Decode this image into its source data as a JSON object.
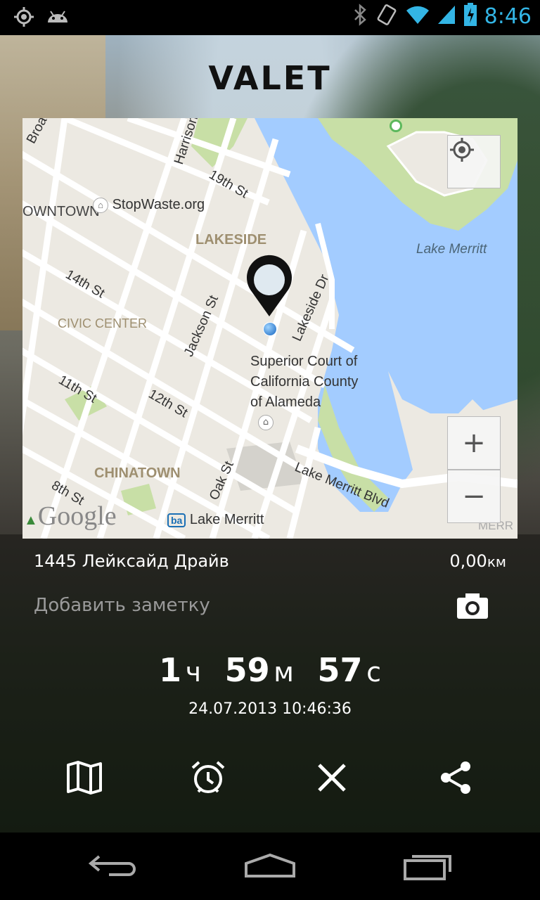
{
  "status_bar": {
    "time": "8:46",
    "icons": [
      "location-icon",
      "android-icon",
      "bluetooth-icon",
      "vibrate-icon",
      "wifi-icon",
      "signal-icon",
      "battery-charging-icon"
    ]
  },
  "app": {
    "title": "VALET"
  },
  "map": {
    "labels": {
      "broadway": "Broadway",
      "harrison": "Harrison",
      "st19": "19th St",
      "downtown": "OWNTOWN",
      "stopwaste": "StopWaste.org",
      "lakeside": "LAKESIDE",
      "lake_merritt": "Lake Merritt",
      "st14": "14th St",
      "lakeside_dr": "Lakeside Dr",
      "civic_center": "CIVIC CENTER",
      "jackson": "Jackson St",
      "court_1": "Superior Court of",
      "court_2": "California County",
      "court_3": "of Alameda",
      "st11": "11th St",
      "st12": "12th St",
      "chinatown": "CHINATOWN",
      "oak": "Oak St",
      "st8": "8th St",
      "lake_merritt_blvd": "Lake Merritt Blvd",
      "bart_station": "Lake Merritt",
      "merr": "MERR"
    },
    "logo": "Google",
    "controls": {
      "zoom_in": "+",
      "zoom_out": "−"
    }
  },
  "parking": {
    "address": "1445 Лейксайд Драйв",
    "distance_value": "0,00",
    "distance_unit": "км",
    "note_placeholder": "Добавить заметку"
  },
  "timer": {
    "hours": "1",
    "hours_unit": "ч",
    "minutes": "59",
    "minutes_unit": "м",
    "seconds": "57",
    "seconds_unit": "с"
  },
  "timestamp": "24.07.2013 10:46:36",
  "actions": [
    "map-icon",
    "alarm-icon",
    "close-icon",
    "share-icon"
  ],
  "nav": [
    "back-icon",
    "home-icon",
    "recents-icon"
  ],
  "colors": {
    "clock": "#33b5e5",
    "water": "#a3ccff",
    "park": "#c8dfa6"
  }
}
